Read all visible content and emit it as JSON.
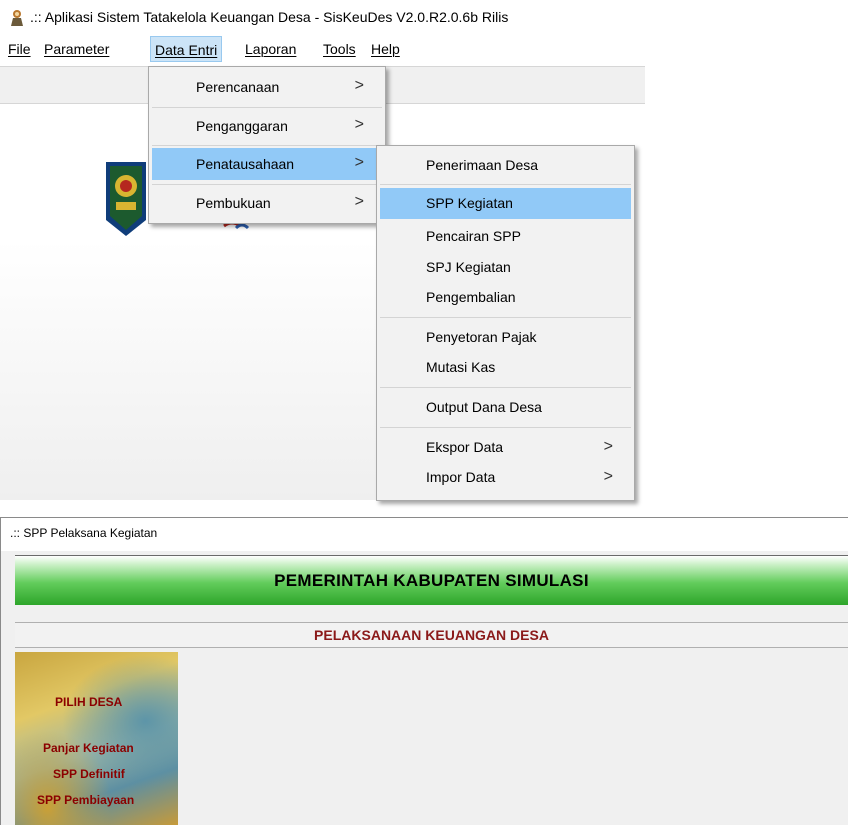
{
  "window": {
    "title": ".:: Aplikasi Sistem Tatakelola Keuangan Desa - SisKeuDes V2.0.R2.0.6b Rilis"
  },
  "menubar": [
    {
      "label": "File"
    },
    {
      "label": "Parameter"
    },
    {
      "label": "Data Entri"
    },
    {
      "label": "Laporan"
    },
    {
      "label": "Tools"
    },
    {
      "label": "Help"
    }
  ],
  "data_entri_menu": [
    {
      "label": "Perencanaan",
      "has_submenu": true
    },
    {
      "label": "Penganggaran",
      "has_submenu": true
    },
    {
      "label": "Penatausahaan",
      "has_submenu": true,
      "highlighted": true
    },
    {
      "label": "Pembukuan",
      "has_submenu": true
    }
  ],
  "penatausahaan_menu": [
    {
      "label": "Penerimaan Desa"
    },
    {
      "label": "SPP Kegiatan",
      "highlighted": true
    },
    {
      "label": "Pencairan SPP"
    },
    {
      "label": "SPJ Kegiatan"
    },
    {
      "label": "Pengembalian"
    },
    {
      "label": "Penyetoran Pajak"
    },
    {
      "label": "Mutasi Kas"
    },
    {
      "label": "Output Dana Desa"
    },
    {
      "label": "Ekspor Data",
      "has_submenu": true
    },
    {
      "label": "Impor Data",
      "has_submenu": true
    }
  ],
  "submenu_arrow": ">",
  "spp_window": {
    "title": ".:: SPP Pelaksana Kegiatan",
    "header": "PEMERINTAH KABUPATEN SIMULASI",
    "subheader": "PELAKSANAAN KEUANGAN DESA",
    "side_menu": [
      {
        "label": "PILIH DESA"
      },
      {
        "label": "Panjar Kegiatan"
      },
      {
        "label": "SPP Definitif"
      },
      {
        "label": "SPP Pembiayaan"
      }
    ]
  },
  "colors": {
    "menu_highlight": "#91c9f7",
    "menubar_active": "#cce4f7",
    "header_green": "#2da52a",
    "subheader_red": "#8b1a1a",
    "side_menu_text": "#8b0000"
  },
  "icons": {
    "app": "app-logo-icon",
    "submenu": "chevron-right-icon",
    "emblem": "garuda-emblem-icon"
  }
}
